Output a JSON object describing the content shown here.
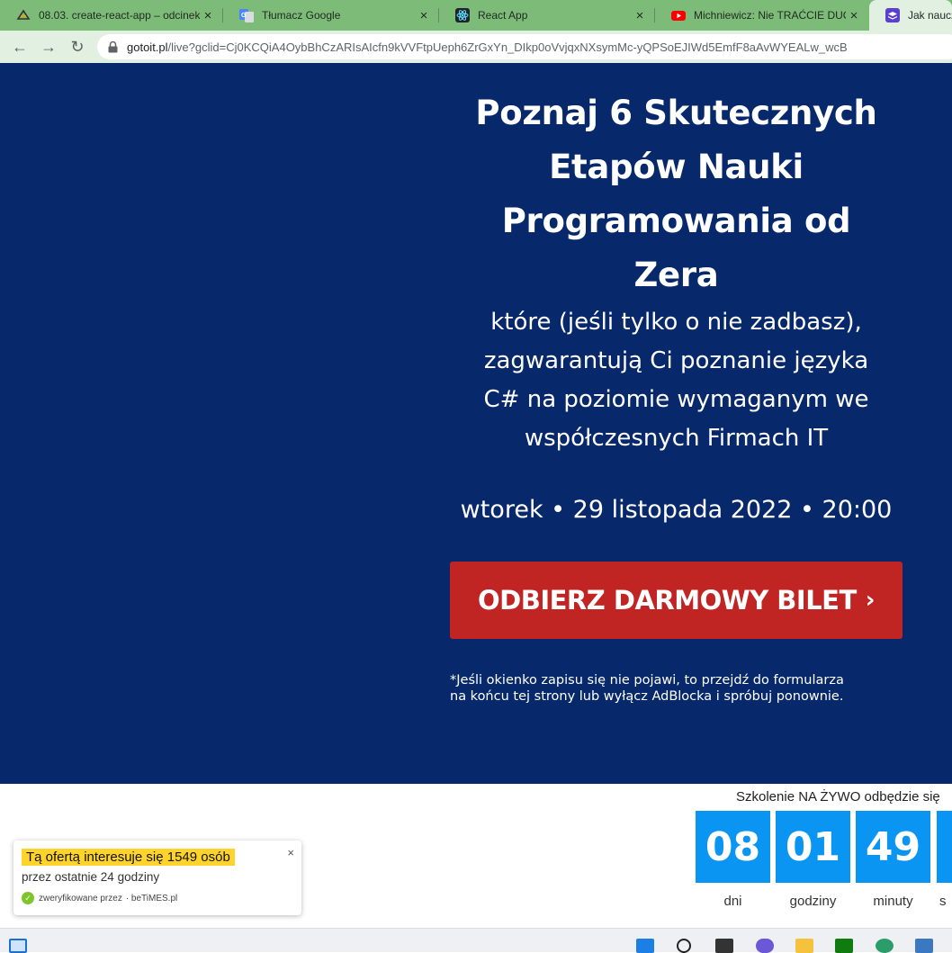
{
  "browser": {
    "tabs": [
      {
        "title": "08.03. create-react-app – odcinek",
        "icon": "shield-icon",
        "close": "×"
      },
      {
        "title": "Tłumacz Google",
        "icon": "google-translate-icon",
        "close": "×"
      },
      {
        "title": "React App",
        "icon": "react-icon",
        "close": "×"
      },
      {
        "title": "Michniewicz: Nie TRAĆCIE DUCHA",
        "icon": "youtube-icon",
        "close": "×"
      },
      {
        "title": "Jak nauczyć",
        "icon": "layers-icon",
        "close": ""
      }
    ],
    "nav": {
      "back": "←",
      "forward": "→",
      "reload": "↻"
    },
    "address": {
      "host": "gotoit.pl",
      "path": "/live?gclid=Cj0KCQiA4OybBhCzARIsAIcfn9kVVFtpUeph6ZrGxYn_DIkp0oVvjqxNXsymMc-yQPSoEJIWd5EmfF8aAvWYEALw_wcB"
    }
  },
  "hero": {
    "headline": [
      "Poznaj 6 Skutecznych",
      "Etapów Nauki",
      "Programowania od",
      "Zera"
    ],
    "subheadline": [
      "które (jeśli tylko o nie zadbasz),",
      "zagwarantują Ci poznanie języka",
      "C# na poziomie wymaganym we",
      "współczesnych Firmach IT"
    ],
    "datetime": "wtorek • 29 listopada 2022 • 20:00",
    "cta_label": "ODBIERZ DARMOWY BILET",
    "cta_chevron": "›",
    "note": [
      "*Jeśli okienko zapisu się nie pojawi, to przejdź do formularza",
      "na końcu tej strony lub wyłącz AdBlocka i spróbuj ponownie."
    ],
    "colors": {
      "background": "#07296b",
      "cta": "#c12523"
    }
  },
  "countdown": {
    "label": "Szkolenie NA ŻYWO odbędzie się",
    "units": [
      {
        "value": "08",
        "label": "dni"
      },
      {
        "value": "01",
        "label": "godziny"
      },
      {
        "value": "49",
        "label": "minuty"
      },
      {
        "value": "",
        "label": "s"
      }
    ],
    "color": "#0b95f3"
  },
  "popup": {
    "highlight": "Tą ofertą interesuje się 1549 osób",
    "sub": "przez ostatnie 24 godziny",
    "verified_by": "zweryfikowane przez",
    "brand": "· beTiMES.pl",
    "close": "×"
  }
}
